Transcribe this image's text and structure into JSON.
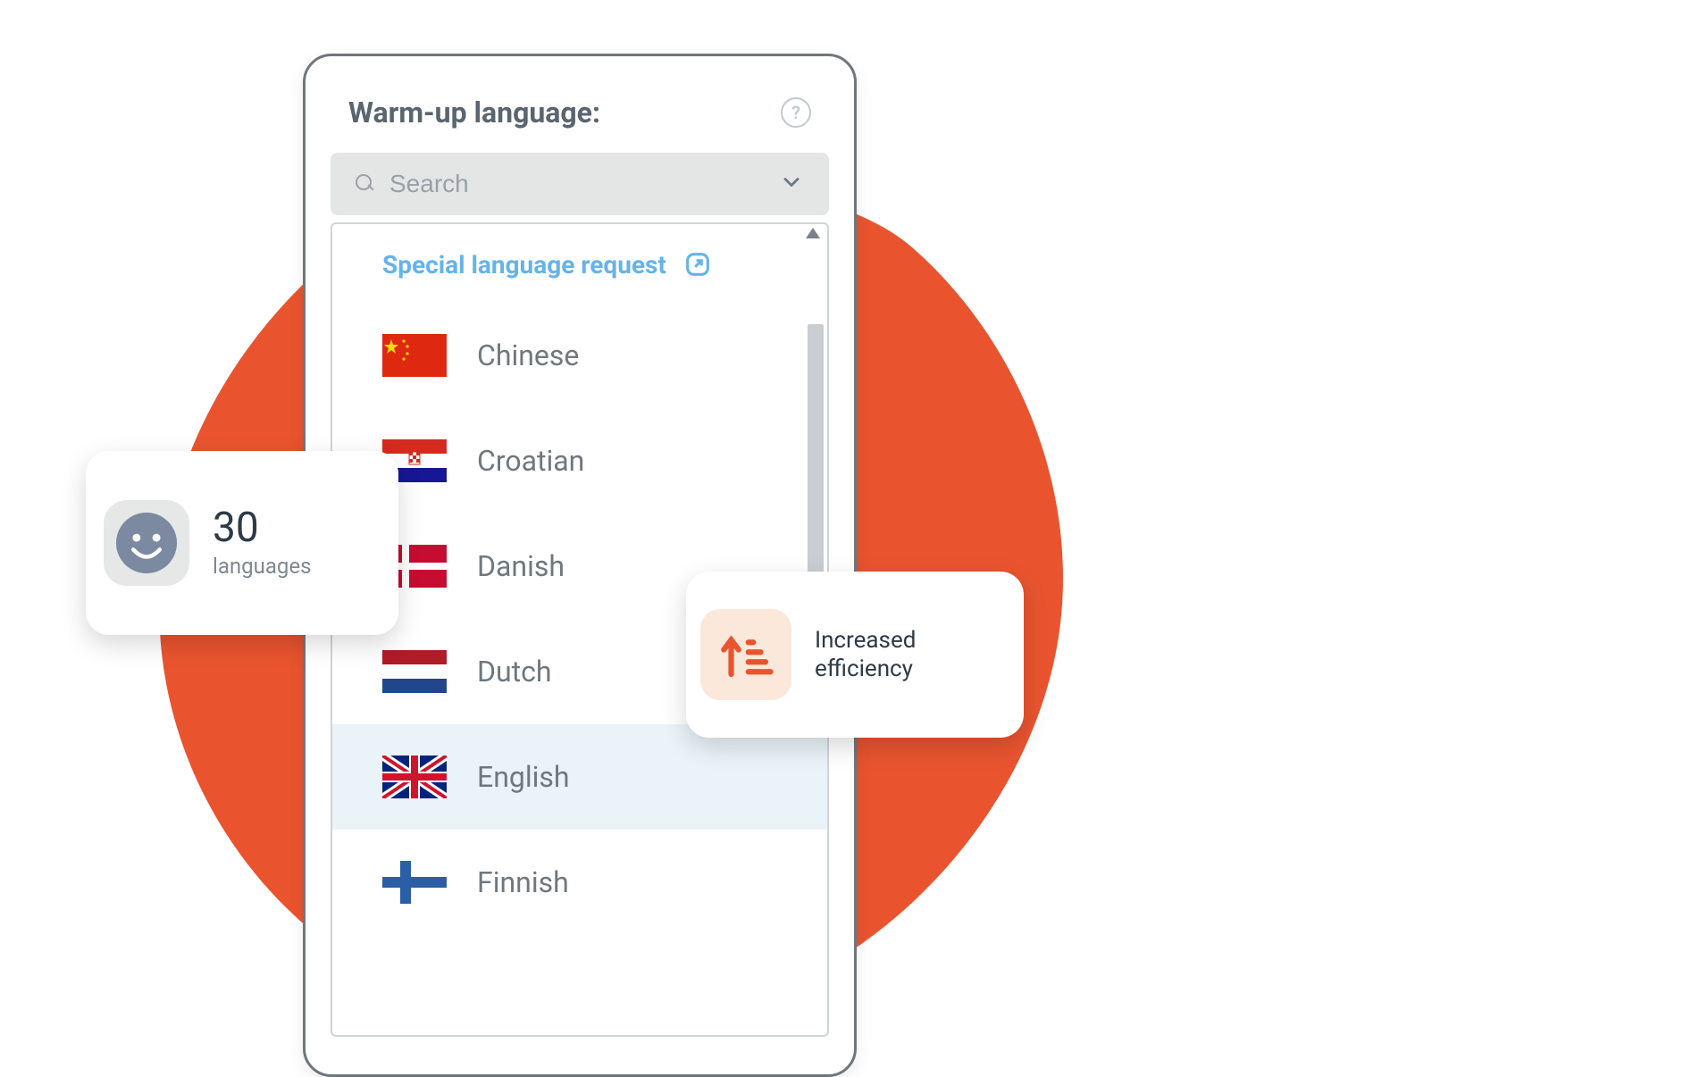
{
  "card": {
    "title": "Warm-up language:",
    "search_placeholder": "Search",
    "special_request_label": "Special language request"
  },
  "languages": [
    {
      "label": "Chinese",
      "flag": "cn",
      "selected": false
    },
    {
      "label": "Croatian",
      "flag": "hr",
      "selected": false
    },
    {
      "label": "Danish",
      "flag": "dk",
      "selected": false
    },
    {
      "label": "Dutch",
      "flag": "nl",
      "selected": false
    },
    {
      "label": "English",
      "flag": "gb",
      "selected": true
    },
    {
      "label": "Finnish",
      "flag": "fi",
      "selected": false
    }
  ],
  "badges": {
    "left": {
      "count": "30",
      "caption": "languages"
    },
    "right": {
      "line1": "Increased",
      "line2": "efficiency"
    }
  },
  "colors": {
    "accent": "#e9542f",
    "link": "#66b3e9",
    "text_muted": "#6f7880"
  }
}
